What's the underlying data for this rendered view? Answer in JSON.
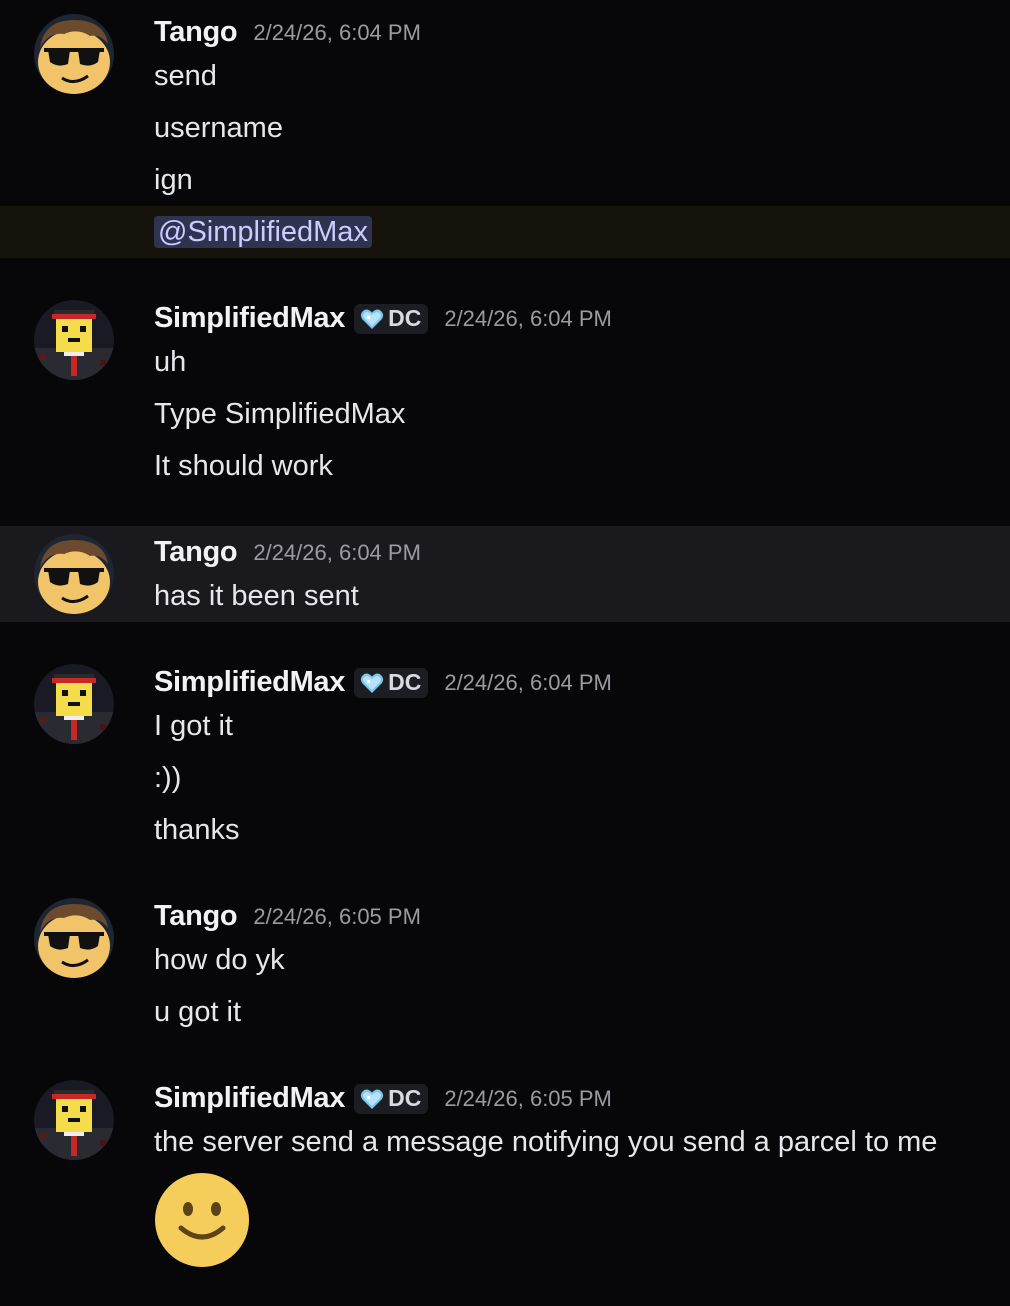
{
  "colors": {
    "background": "#070709",
    "mention_bg": "#2f3350",
    "mention_text": "#c9cdff",
    "mentioned_row_bg": "#15130c",
    "hover_row_bg": "#1a1a1e"
  },
  "messages": [
    {
      "author": "Tango",
      "avatar": "sunglasses-avatar-icon",
      "timestamp": "2/24/26, 6:04 PM",
      "lines": [
        "send",
        "username",
        "ign"
      ],
      "mention": "@SimplifiedMax"
    },
    {
      "author": "SimplifiedMax",
      "avatar": "blocky-avatar-icon",
      "tag": "DC",
      "timestamp": "2/24/26, 6:04 PM",
      "lines": [
        "uh",
        "Type SimplifiedMax",
        "It should work"
      ]
    },
    {
      "author": "Tango",
      "avatar": "sunglasses-avatar-icon",
      "timestamp": "2/24/26, 6:04 PM",
      "lines": [
        "has it been sent"
      ]
    },
    {
      "author": "SimplifiedMax",
      "avatar": "blocky-avatar-icon",
      "tag": "DC",
      "timestamp": "2/24/26, 6:04 PM",
      "lines": [
        "I got it",
        ":))",
        "thanks"
      ]
    },
    {
      "author": "Tango",
      "avatar": "sunglasses-avatar-icon",
      "timestamp": "2/24/26, 6:05 PM",
      "lines": [
        "how do yk",
        "u got it"
      ]
    },
    {
      "author": "SimplifiedMax",
      "avatar": "blocky-avatar-icon",
      "tag": "DC",
      "timestamp": "2/24/26, 6:05 PM",
      "lines": [
        "the server send a message notifying you send a parcel to me"
      ],
      "emoji": "slightly-smiling-face-icon"
    }
  ]
}
